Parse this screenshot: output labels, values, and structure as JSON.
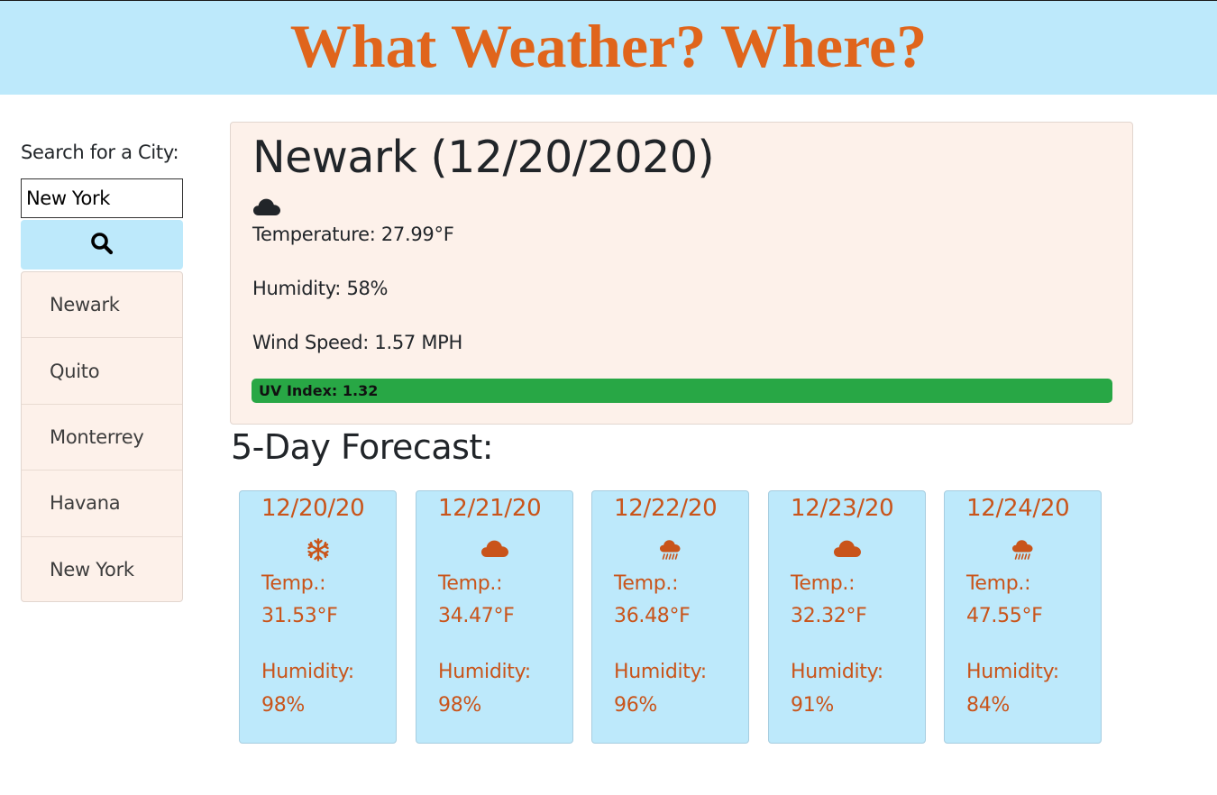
{
  "header": {
    "title": "What Weather? Where?"
  },
  "search": {
    "label": "Search for a City:",
    "value": "New York",
    "button_icon": "search-icon"
  },
  "history": [
    "Newark",
    "Quito",
    "Monterrey",
    "Havana",
    "New York"
  ],
  "current": {
    "title": "Newark (12/20/2020)",
    "icon": "cloud-icon",
    "temperature": "Temperature: 27.99°F",
    "humidity": "Humidity: 58%",
    "wind": "Wind Speed: 1.57 MPH",
    "uv": "UV Index: 1.32",
    "uv_color": "#28a745"
  },
  "forecast": {
    "title": "5-Day Forecast:",
    "temp_label": "Temp.:",
    "humidity_label": "Humidity:",
    "days": [
      {
        "date": "12/20/20",
        "icon": "snowflake-icon",
        "temp": "31.53°F",
        "humidity": "98%"
      },
      {
        "date": "12/21/20",
        "icon": "cloud-icon",
        "temp": "34.47°F",
        "humidity": "98%"
      },
      {
        "date": "12/22/20",
        "icon": "cloud-rain-icon",
        "temp": "36.48°F",
        "humidity": "96%"
      },
      {
        "date": "12/23/20",
        "icon": "cloud-icon",
        "temp": "32.32°F",
        "humidity": "91%"
      },
      {
        "date": "12/24/20",
        "icon": "cloud-rain-icon",
        "temp": "47.55°F",
        "humidity": "84%"
      }
    ]
  },
  "colors": {
    "header_bg": "#bde9fb",
    "title": "#e0651c",
    "forecast_text": "#c9541a",
    "panel_bg": "#fdf1ea"
  }
}
